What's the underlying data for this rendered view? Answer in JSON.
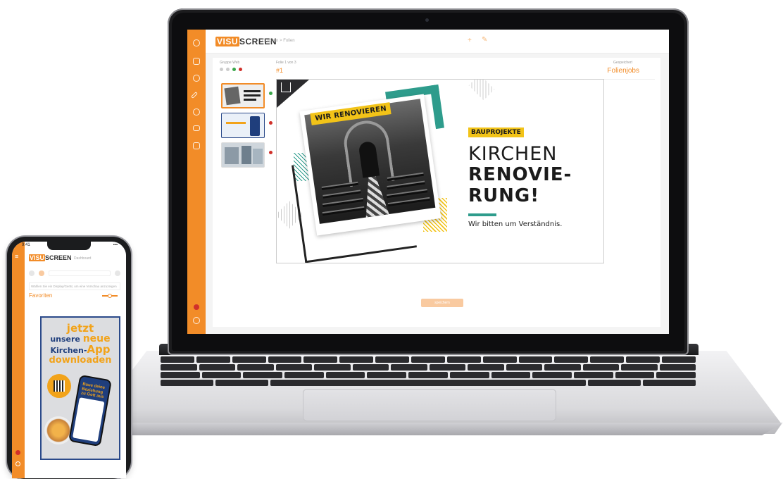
{
  "laptop": {
    "app": {
      "logo_box": "VISU",
      "logo_rest": "SCREEN",
      "breadcrumb": "Gruppen > Folien",
      "top_actions": {
        "add_glyph": "+",
        "edit_glyph": "✎"
      },
      "group_label": "Gruppe Web",
      "slide_label": "Folie 1 von 3",
      "slide_number": "#1",
      "selection_label": "Gespeichert",
      "selection_value": "Folienjobs",
      "save_button": "speichern",
      "sidebar_icons": [
        "home-icon",
        "slides-icon",
        "layers-icon",
        "pen-icon",
        "clock-icon",
        "monitor-icon",
        "calendar-icon"
      ],
      "thumbnail_status": [
        "#3aa64a",
        "#d0302a",
        "#d0302a"
      ]
    },
    "slide": {
      "badge": "WIR RENOVIEREN",
      "tag": "BAUPROJEKTE",
      "headline_1": "KIRCHEN",
      "headline_2": "RENOVIE-",
      "headline_3": "RUNG!",
      "subline": "Wir bitten um Verständnis."
    }
  },
  "phone": {
    "status_time": "9:41",
    "status_right": "▪▪▪",
    "logo_box": "VISU",
    "logo_rest": "SCREEN",
    "breadcrumb": "Dashboard",
    "hint": "Wählen Sie ein Display/Gerät, um eine Vorschau anzuzeigen",
    "favorites_label": "Favoriten",
    "poster": {
      "line1": "jetzt",
      "line2a": "unsere ",
      "line2b": "neue",
      "line3a": "Kirchen-",
      "line3b": "App",
      "line4": "downloaden",
      "mini_text": "Baue deine Beziehung zu Gott aus"
    }
  },
  "colors": {
    "brand_orange": "#f28c28",
    "teal": "#2e9c8c",
    "yellow": "#f2c318",
    "navy": "#1f3e7c"
  }
}
